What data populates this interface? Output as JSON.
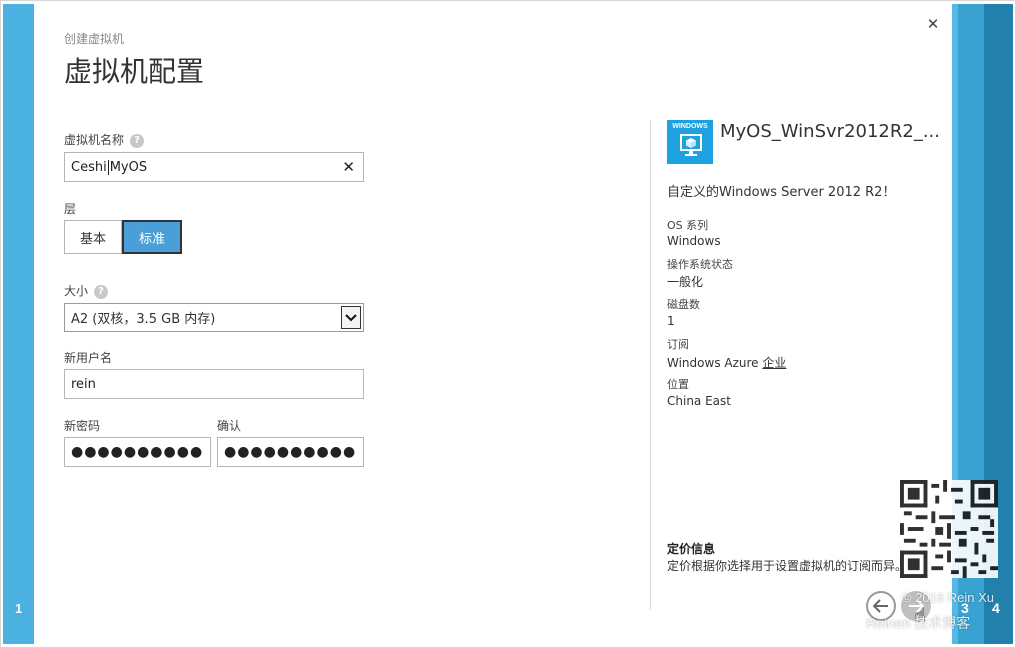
{
  "wizard": {
    "breadcrumb": "创建虚拟机",
    "title": "虚拟机配置",
    "close_icon": "close-icon",
    "steps": {
      "left": "1",
      "right_3": "3",
      "right_4": "4"
    }
  },
  "form": {
    "vm_name": {
      "label": "虚拟机名称",
      "value_before_caret": "Ceshi",
      "value_after_caret": "MyOS"
    },
    "tier": {
      "label": "层",
      "options": [
        "基本",
        "标准"
      ],
      "selected": "标准"
    },
    "size": {
      "label": "大小",
      "selected": "A2 (双核，3.5 GB 内存)"
    },
    "username": {
      "label": "新用户名",
      "value": "rein"
    },
    "password": {
      "label": "新密码",
      "value": "●●●●●●●●●●"
    },
    "confirm": {
      "label": "确认",
      "value": "●●●●●●●●●●"
    }
  },
  "summary": {
    "os_logo_text": "WINDOWS",
    "os_name": "MyOS_WinSvr2012R2_...",
    "description": "自定义的Windows Server 2012 R2！",
    "meta": [
      {
        "key": "OS 系列",
        "value": "Windows"
      },
      {
        "key": "操作系统状态",
        "value": "一般化"
      },
      {
        "key": "磁盘数",
        "value": "1"
      },
      {
        "key": "订阅",
        "value_prefix": "Windows Azure ",
        "value_link": "企业"
      },
      {
        "key": "位置",
        "value": "China East"
      }
    ],
    "pricing_title": "定价信息",
    "pricing_text": "定价根据你选择用于设置虚拟机的订阅而异。"
  },
  "watermark": {
    "line1": "© 2016 Rein Xu",
    "line2": "Reinen       技术博客"
  },
  "colors": {
    "accent": "#4ab1e0",
    "selected_tier": "#4a9fd8",
    "os_logo": "#1ea1e0"
  }
}
